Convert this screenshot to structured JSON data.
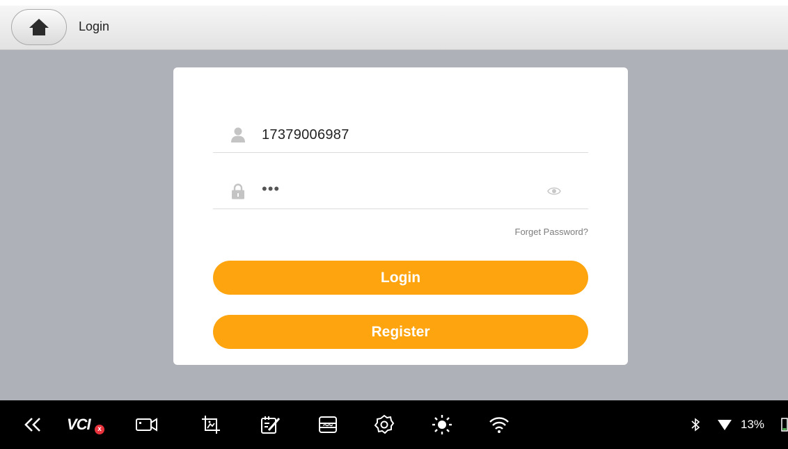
{
  "header": {
    "title": "Login",
    "home_icon": "home-icon"
  },
  "login_form": {
    "username_value": "17379006987",
    "password_masked": "•••",
    "forget_password_label": "Forget Password?",
    "login_label": "Login",
    "register_label": "Register"
  },
  "taskbar": {
    "items": [
      "back-icon",
      "vci",
      "camera-icon",
      "screenshot-icon",
      "notes-icon",
      "archive-icon",
      "settings-icon",
      "brightness-icon",
      "wifi-icon"
    ],
    "vci_label": "VCI",
    "vci_badge": "x",
    "battery_percent": "13%"
  },
  "colors": {
    "accent": "#fda40f",
    "background": "#aeb1b8",
    "card": "#ffffff",
    "taskbar": "#000000"
  }
}
